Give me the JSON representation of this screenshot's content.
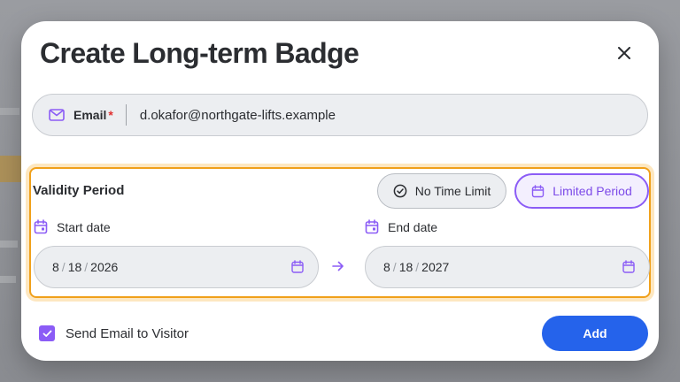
{
  "modal": {
    "title": "Create Long-term Badge"
  },
  "email": {
    "label": "Email",
    "required_mark": "*",
    "value": "d.okafor@northgate-lifts.example"
  },
  "validity": {
    "title": "Validity Period",
    "options": [
      {
        "label": "No Time Limit",
        "selected": false
      },
      {
        "label": "Limited Period",
        "selected": true
      }
    ],
    "start": {
      "label": "Start date",
      "month": "8",
      "day": "18",
      "year": "2026"
    },
    "end": {
      "label": "End date",
      "month": "8",
      "day": "18",
      "year": "2027"
    },
    "separator": "/"
  },
  "footer": {
    "send_email_label": "Send Email to Visitor",
    "send_email_checked": true,
    "add_label": "Add"
  },
  "colors": {
    "accent_purple": "#8b5cf6",
    "primary_blue": "#2563eb",
    "focus_orange": "#f0a01a",
    "required_red": "#e03131"
  },
  "icons": {
    "close": "close-icon",
    "email": "mail-icon",
    "no_limit": "check-circle-icon",
    "limited": "calendar-icon",
    "date_label": "calendar-event-icon",
    "date_picker": "calendar-icon",
    "range_arrow": "arrow-right-icon",
    "checkbox": "checkmark-icon"
  }
}
